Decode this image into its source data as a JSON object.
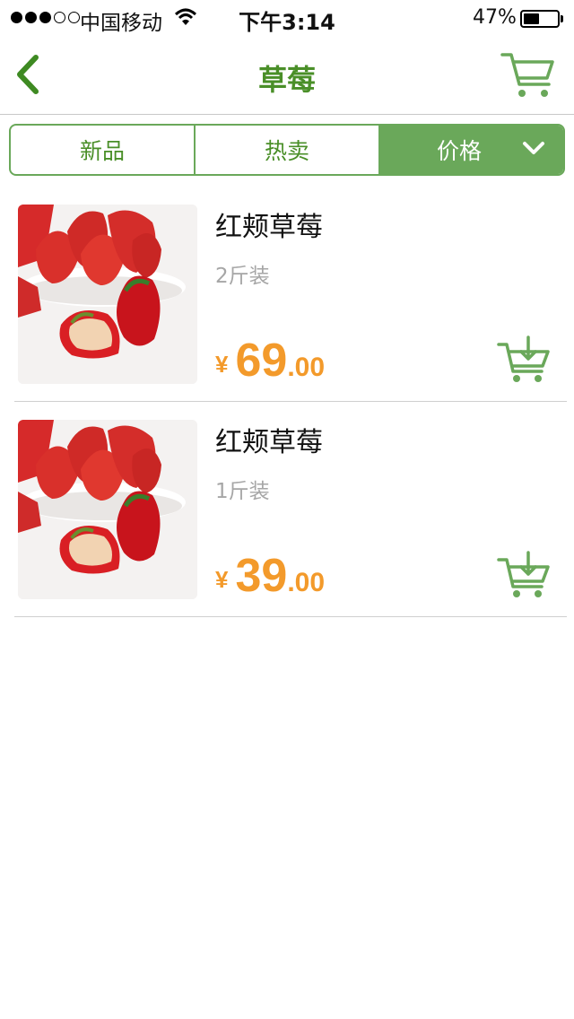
{
  "status_bar": {
    "carrier": "中国移动",
    "time": "下午3:14",
    "battery_percent": "47%",
    "battery_level": 0.47,
    "signal_bars_filled": 3,
    "signal_bars_total": 5
  },
  "nav": {
    "title": "草莓",
    "back_icon": "chevron-left-icon",
    "cart_icon": "shopping-cart-icon"
  },
  "tabs": [
    {
      "label": "新品",
      "active": false
    },
    {
      "label": "热卖",
      "active": false
    },
    {
      "label": "价格",
      "active": true,
      "icon": "chevron-down-icon"
    }
  ],
  "products": [
    {
      "name": "红颊草莓",
      "spec": "2斤装",
      "currency": "¥",
      "price_int": "69",
      "price_dec": ".00",
      "add_icon": "add-to-cart-icon"
    },
    {
      "name": "红颊草莓",
      "spec": "1斤装",
      "currency": "¥",
      "price_int": "39",
      "price_dec": ".00",
      "add_icon": "add-to-cart-icon"
    }
  ],
  "colors": {
    "accent_green": "#6aa85a",
    "title_green": "#4a8f28",
    "price_orange": "#f39a2b",
    "muted_text": "#a6a6a6"
  }
}
